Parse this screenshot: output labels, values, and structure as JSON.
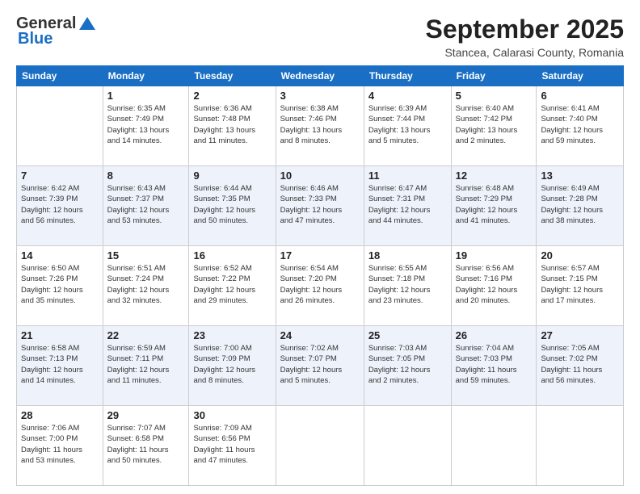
{
  "header": {
    "logo_general": "General",
    "logo_blue": "Blue",
    "title": "September 2025",
    "subtitle": "Stancea, Calarasi County, Romania"
  },
  "days_of_week": [
    "Sunday",
    "Monday",
    "Tuesday",
    "Wednesday",
    "Thursday",
    "Friday",
    "Saturday"
  ],
  "weeks": [
    [
      {
        "day": "",
        "info": ""
      },
      {
        "day": "1",
        "info": "Sunrise: 6:35 AM\nSunset: 7:49 PM\nDaylight: 13 hours\nand 14 minutes."
      },
      {
        "day": "2",
        "info": "Sunrise: 6:36 AM\nSunset: 7:48 PM\nDaylight: 13 hours\nand 11 minutes."
      },
      {
        "day": "3",
        "info": "Sunrise: 6:38 AM\nSunset: 7:46 PM\nDaylight: 13 hours\nand 8 minutes."
      },
      {
        "day": "4",
        "info": "Sunrise: 6:39 AM\nSunset: 7:44 PM\nDaylight: 13 hours\nand 5 minutes."
      },
      {
        "day": "5",
        "info": "Sunrise: 6:40 AM\nSunset: 7:42 PM\nDaylight: 13 hours\nand 2 minutes."
      },
      {
        "day": "6",
        "info": "Sunrise: 6:41 AM\nSunset: 7:40 PM\nDaylight: 12 hours\nand 59 minutes."
      }
    ],
    [
      {
        "day": "7",
        "info": "Sunrise: 6:42 AM\nSunset: 7:39 PM\nDaylight: 12 hours\nand 56 minutes."
      },
      {
        "day": "8",
        "info": "Sunrise: 6:43 AM\nSunset: 7:37 PM\nDaylight: 12 hours\nand 53 minutes."
      },
      {
        "day": "9",
        "info": "Sunrise: 6:44 AM\nSunset: 7:35 PM\nDaylight: 12 hours\nand 50 minutes."
      },
      {
        "day": "10",
        "info": "Sunrise: 6:46 AM\nSunset: 7:33 PM\nDaylight: 12 hours\nand 47 minutes."
      },
      {
        "day": "11",
        "info": "Sunrise: 6:47 AM\nSunset: 7:31 PM\nDaylight: 12 hours\nand 44 minutes."
      },
      {
        "day": "12",
        "info": "Sunrise: 6:48 AM\nSunset: 7:29 PM\nDaylight: 12 hours\nand 41 minutes."
      },
      {
        "day": "13",
        "info": "Sunrise: 6:49 AM\nSunset: 7:28 PM\nDaylight: 12 hours\nand 38 minutes."
      }
    ],
    [
      {
        "day": "14",
        "info": "Sunrise: 6:50 AM\nSunset: 7:26 PM\nDaylight: 12 hours\nand 35 minutes."
      },
      {
        "day": "15",
        "info": "Sunrise: 6:51 AM\nSunset: 7:24 PM\nDaylight: 12 hours\nand 32 minutes."
      },
      {
        "day": "16",
        "info": "Sunrise: 6:52 AM\nSunset: 7:22 PM\nDaylight: 12 hours\nand 29 minutes."
      },
      {
        "day": "17",
        "info": "Sunrise: 6:54 AM\nSunset: 7:20 PM\nDaylight: 12 hours\nand 26 minutes."
      },
      {
        "day": "18",
        "info": "Sunrise: 6:55 AM\nSunset: 7:18 PM\nDaylight: 12 hours\nand 23 minutes."
      },
      {
        "day": "19",
        "info": "Sunrise: 6:56 AM\nSunset: 7:16 PM\nDaylight: 12 hours\nand 20 minutes."
      },
      {
        "day": "20",
        "info": "Sunrise: 6:57 AM\nSunset: 7:15 PM\nDaylight: 12 hours\nand 17 minutes."
      }
    ],
    [
      {
        "day": "21",
        "info": "Sunrise: 6:58 AM\nSunset: 7:13 PM\nDaylight: 12 hours\nand 14 minutes."
      },
      {
        "day": "22",
        "info": "Sunrise: 6:59 AM\nSunset: 7:11 PM\nDaylight: 12 hours\nand 11 minutes."
      },
      {
        "day": "23",
        "info": "Sunrise: 7:00 AM\nSunset: 7:09 PM\nDaylight: 12 hours\nand 8 minutes."
      },
      {
        "day": "24",
        "info": "Sunrise: 7:02 AM\nSunset: 7:07 PM\nDaylight: 12 hours\nand 5 minutes."
      },
      {
        "day": "25",
        "info": "Sunrise: 7:03 AM\nSunset: 7:05 PM\nDaylight: 12 hours\nand 2 minutes."
      },
      {
        "day": "26",
        "info": "Sunrise: 7:04 AM\nSunset: 7:03 PM\nDaylight: 11 hours\nand 59 minutes."
      },
      {
        "day": "27",
        "info": "Sunrise: 7:05 AM\nSunset: 7:02 PM\nDaylight: 11 hours\nand 56 minutes."
      }
    ],
    [
      {
        "day": "28",
        "info": "Sunrise: 7:06 AM\nSunset: 7:00 PM\nDaylight: 11 hours\nand 53 minutes."
      },
      {
        "day": "29",
        "info": "Sunrise: 7:07 AM\nSunset: 6:58 PM\nDaylight: 11 hours\nand 50 minutes."
      },
      {
        "day": "30",
        "info": "Sunrise: 7:09 AM\nSunset: 6:56 PM\nDaylight: 11 hours\nand 47 minutes."
      },
      {
        "day": "",
        "info": ""
      },
      {
        "day": "",
        "info": ""
      },
      {
        "day": "",
        "info": ""
      },
      {
        "day": "",
        "info": ""
      }
    ]
  ]
}
